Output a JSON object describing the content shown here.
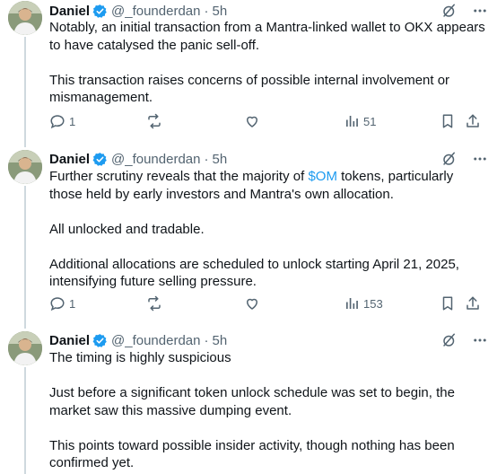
{
  "colors": {
    "accent": "#1d9bf0",
    "text": "#0f1419",
    "muted": "#536471",
    "line": "#cfd9de"
  },
  "tweets": [
    {
      "author": {
        "name": "Daniel",
        "handle": "@_founderdan"
      },
      "separator": "·",
      "time": "5h",
      "paragraphs": [
        "Notably, an initial transaction from a Mantra-linked wallet to OKX appears to have catalysed the panic sell-off.",
        "This transaction raises concerns of possible internal involvement or mismanagement."
      ],
      "stats": {
        "replies": "1",
        "views": "51"
      }
    },
    {
      "author": {
        "name": "Daniel",
        "handle": "@_founderdan"
      },
      "separator": "·",
      "time": "5h",
      "p1_before": "Further scrutiny reveals that the majority of ",
      "p1_cashtag": "$OM",
      "p1_after": " tokens, particularly those held by early investors and Mantra's own allocation.",
      "paragraphs": [
        "",
        "All unlocked and tradable.",
        "Additional allocations are scheduled to unlock starting April 21, 2025, intensifying future selling pressure."
      ],
      "stats": {
        "replies": "1",
        "views": "153"
      }
    },
    {
      "author": {
        "name": "Daniel",
        "handle": "@_founderdan"
      },
      "separator": "·",
      "time": "5h",
      "paragraphs": [
        "The timing is highly suspicious",
        "Just before a significant token unlock schedule was set to begin, the market saw this massive dumping event.",
        "This points toward possible insider activity, though nothing has been confirmed yet."
      ]
    }
  ]
}
